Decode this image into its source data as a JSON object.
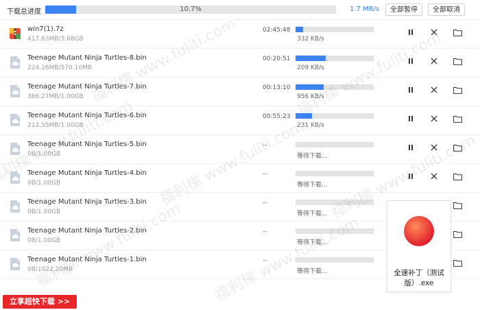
{
  "topbar": {
    "label": "下载总进度",
    "progress_fraction": 0.107,
    "progress_text": "10.7%",
    "speed": "1.7 MB/s",
    "pause_all": "全部暂停",
    "cancel_all": "全部取消"
  },
  "downloads": [
    {
      "name": "win7(1).7z",
      "size": "417.63MB/3.68GB",
      "time": "02:45:48",
      "progress": 0.1,
      "status": "332 KB/s",
      "type": "archive"
    },
    {
      "name": "Teenage Mutant Ninja Turtles-8.bin",
      "size": "224.16MB/570.10MB",
      "time": "00:20:51",
      "progress": 0.39,
      "status": "209 KB/s",
      "type": "file"
    },
    {
      "name": "Teenage Mutant Ninja Turtles-7.bin",
      "size": "366.27MB/1.00GB",
      "time": "00:13:10",
      "progress": 0.36,
      "status": "956 KB/s",
      "type": "file"
    },
    {
      "name": "Teenage Mutant Ninja Turtles-6.bin",
      "size": "212.55MB/1.00GB",
      "time": "00:55:23",
      "progress": 0.21,
      "status": "231 KB/s",
      "type": "file"
    },
    {
      "name": "Teenage Mutant Ninja Turtles-5.bin",
      "size": "0B/1.00GB",
      "time": "--",
      "progress": 0,
      "status": "等待下载...",
      "type": "file"
    },
    {
      "name": "Teenage Mutant Ninja Turtles-4.bin",
      "size": "0B/1.00GB",
      "time": "--",
      "progress": 0,
      "status": "等待下载...",
      "type": "file"
    },
    {
      "name": "Teenage Mutant Ninja Turtles-3.bin",
      "size": "0B/1.00GB",
      "time": "--",
      "progress": 0,
      "status": "等待下载...",
      "type": "file"
    },
    {
      "name": "Teenage Mutant Ninja Turtles-2.bin",
      "size": "0B/1.00GB",
      "time": "--",
      "progress": 0,
      "status": "等待下载...",
      "type": "file"
    },
    {
      "name": "Teenage Mutant Ninja Turtles-1.bin",
      "size": "0B/1022.20MB",
      "time": "--",
      "progress": 0,
      "status": "等待下载...",
      "type": "file"
    }
  ],
  "watermark": {
    "text": "福利梯 www.fuliti.com"
  },
  "promo": {
    "label": "立享超快下载 >>"
  },
  "popup": {
    "line1": "全速补丁（测试",
    "line2": "版）.exe"
  },
  "colors": {
    "accent": "#3b83f2",
    "promo": "#e8262a"
  },
  "icons": {
    "pause": "pause-icon",
    "close": "close-icon",
    "folder": "folder-icon",
    "file": "cloud-file-icon",
    "archive": "archive-icon"
  }
}
